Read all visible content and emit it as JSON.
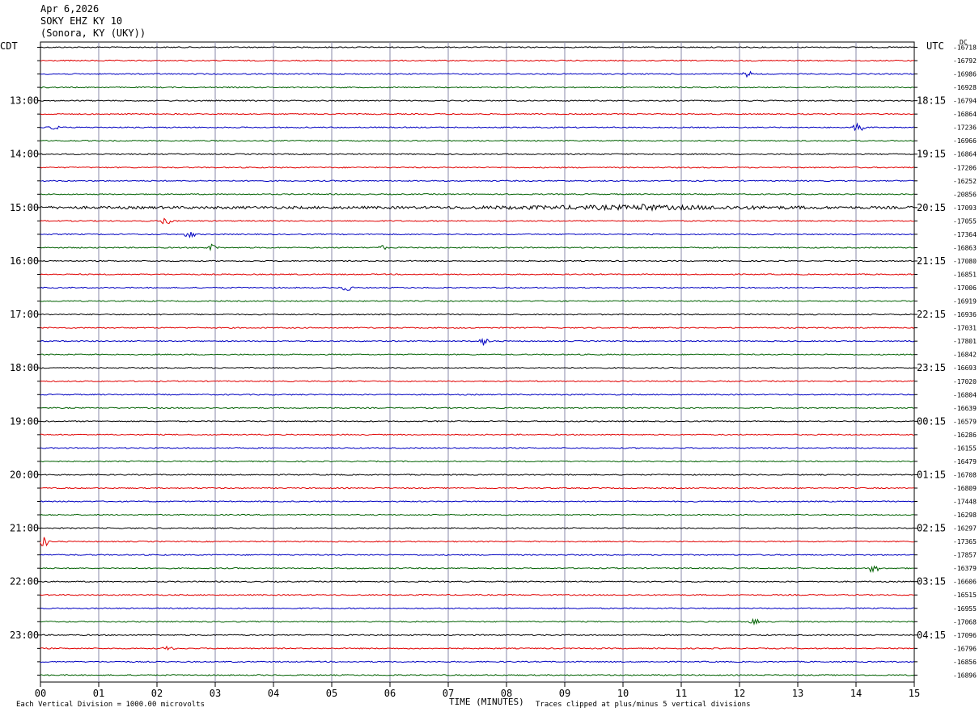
{
  "header": {
    "date": "Apr 6,2026",
    "station": "SOKY EHZ KY 10",
    "location": "(Sonora, KY (UKY))"
  },
  "left_axis_label": "CDT",
  "right_axis_label": "UTC",
  "dc_label": "DC",
  "xaxis_title": "TIME (MINUTES)",
  "footer_left": "Each Vertical Division = 1000.00 microvolts",
  "footer_right": "Traces clipped at plus/minus 5 vertical divisions",
  "chart_data": {
    "type": "line",
    "title": "SOKY EHZ KY 10",
    "xlabel": "TIME (MINUTES)",
    "xlim": [
      0,
      15
    ],
    "x_ticks": [
      "00",
      "01",
      "02",
      "03",
      "04",
      "05",
      "06",
      "07",
      "08",
      "09",
      "10",
      "11",
      "12",
      "13",
      "14",
      "15"
    ],
    "trace_colors": [
      "#000000",
      "#e00000",
      "#0000c0",
      "#006000"
    ],
    "grid": true,
    "cdt_hour_labels": [
      "13:00",
      "14:00",
      "15:00",
      "16:00",
      "17:00",
      "18:00",
      "19:00",
      "20:00",
      "21:00",
      "22:00",
      "23:00"
    ],
    "utc_hour_labels": [
      "18:15",
      "19:15",
      "20:15",
      "21:15",
      "22:15",
      "23:15",
      "00:15",
      "01:15",
      "02:15",
      "03:15",
      "04:15"
    ],
    "dc_offsets": [
      "-16718",
      "-16792",
      "-16986",
      "-16928",
      "-16794",
      "-16864",
      "-17236",
      "-16966",
      "-16864",
      "-17206",
      "-16252",
      "-20856",
      "-17093",
      "-17055",
      "-17364",
      "-16863",
      "-17080",
      "-16851",
      "-17006",
      "-16919",
      "-16936",
      "-17031",
      "-17801",
      "-16842",
      "-16693",
      "-17020",
      "-16804",
      "-16639",
      "-16579",
      "-16286",
      "-16155",
      "-16479",
      "-16708",
      "-16809",
      "-17448",
      "-16298",
      "-16297",
      "-17365",
      "-17857",
      "-16379",
      "-16606",
      "-16515",
      "-16955",
      "-17068",
      "-17096",
      "-16796",
      "-16856",
      "-16896"
    ],
    "events": [
      {
        "trace": 2,
        "minute": 12.15,
        "amp": 4
      },
      {
        "trace": 6,
        "minute": 0.25,
        "amp": 4
      },
      {
        "trace": 6,
        "minute": 14.05,
        "amp": 7
      },
      {
        "trace": 12,
        "minute": 10.4,
        "amp": 4
      },
      {
        "trace": 13,
        "minute": 2.15,
        "amp": 6
      },
      {
        "trace": 14,
        "minute": 2.55,
        "amp": 6
      },
      {
        "trace": 15,
        "minute": 2.95,
        "amp": 5
      },
      {
        "trace": 15,
        "minute": 5.85,
        "amp": 3
      },
      {
        "trace": 18,
        "minute": 5.25,
        "amp": 6
      },
      {
        "trace": 22,
        "minute": 7.6,
        "amp": 6
      },
      {
        "trace": 37,
        "minute": 0.05,
        "amp": 8
      },
      {
        "trace": 39,
        "minute": 14.3,
        "amp": 7
      },
      {
        "trace": 43,
        "minute": 12.25,
        "amp": 4
      },
      {
        "trace": 45,
        "minute": 2.2,
        "amp": 4
      }
    ]
  }
}
